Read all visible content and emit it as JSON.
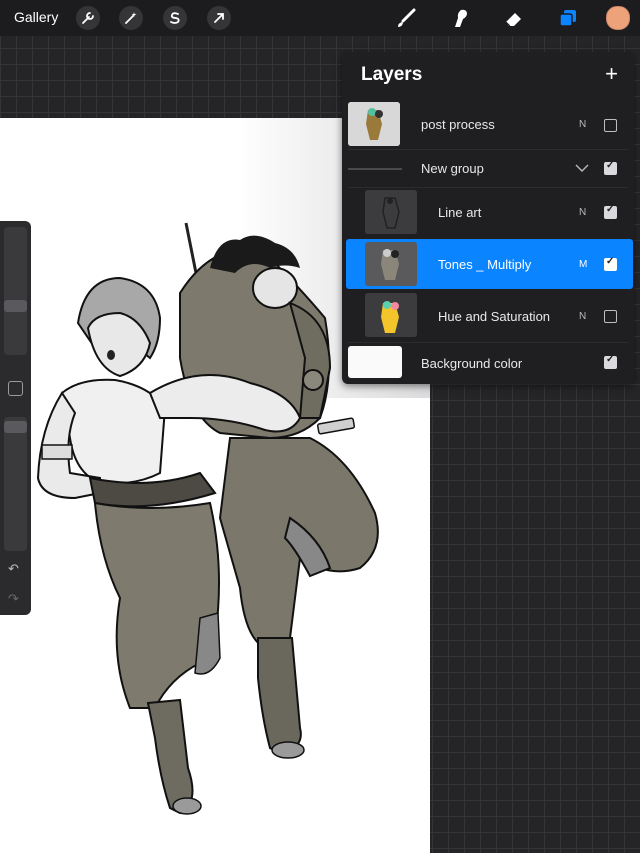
{
  "topbar": {
    "gallery_label": "Gallery",
    "left_tools": [
      "wrench-icon",
      "magic-wand-icon",
      "selection-icon",
      "transform-arrow-icon"
    ],
    "right_tools": [
      "brush-icon",
      "smudge-icon",
      "eraser-icon",
      "layers-icon"
    ],
    "active_tool": "layers-icon",
    "color_swatch": "#eda27a",
    "accent": "#0a84ff"
  },
  "layers_panel": {
    "title": "Layers",
    "add_symbol": "+",
    "layers": [
      {
        "name": "post process",
        "mode": "N",
        "visible": false
      },
      {
        "name": "New group",
        "mode": "",
        "visible": true,
        "group": true
      },
      {
        "name": "Line art",
        "mode": "N",
        "visible": true,
        "indent": true
      },
      {
        "name": "Tones _ Multiply",
        "mode": "M",
        "visible": true,
        "indent": true,
        "selected": true
      },
      {
        "name": "Hue and Saturation",
        "mode": "N",
        "visible": false,
        "indent": true
      },
      {
        "name": "Background color",
        "mode": "",
        "visible": true
      }
    ]
  },
  "sidebar": {
    "undo_symbol": "↶",
    "redo_symbol": "↷"
  }
}
